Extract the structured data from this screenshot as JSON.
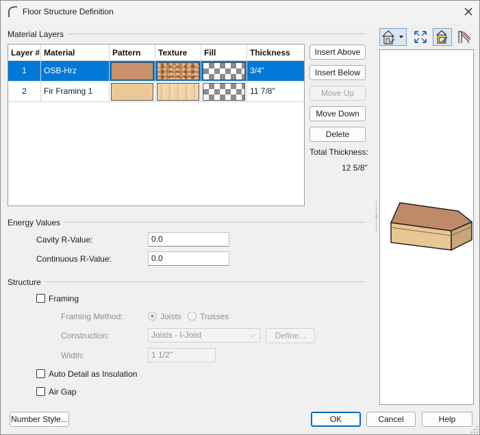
{
  "window": {
    "title": "Floor Structure Definition"
  },
  "material_layers": {
    "section_label": "Material Layers",
    "columns": [
      "Layer #",
      "Material",
      "Pattern",
      "Texture",
      "Fill",
      "Thickness"
    ],
    "rows": [
      {
        "layer": "1",
        "material": "OSB-Hrz",
        "thickness": "3/4\"",
        "selected": true
      },
      {
        "layer": "2",
        "material": "Fir Framing 1",
        "thickness": "11 7/8\"",
        "selected": false
      }
    ],
    "buttons": {
      "insert_above": "Insert Above",
      "insert_below": "Insert Below",
      "move_up": "Move Up",
      "move_down": "Move Down",
      "delete": "Delete"
    },
    "total_thickness_label": "Total Thickness:",
    "total_thickness_value": "12 5/8\""
  },
  "energy_values": {
    "section_label": "Energy Values",
    "cavity_label": "Cavity R-Value:",
    "cavity_value": "0.0",
    "continuous_label": "Continuous R-Value:",
    "continuous_value": "0.0"
  },
  "structure": {
    "section_label": "Structure",
    "framing_label": "Framing",
    "framing_checked": false,
    "framing_method_label": "Framing Method:",
    "joists_label": "Joists",
    "trusses_label": "Trusses",
    "construction_label": "Construction:",
    "construction_value": "Joists - I-Joist",
    "define_button": "Define...",
    "width_label": "Width:",
    "width_value": "1 1/2\"",
    "auto_detail_label": "Auto Detail as Insulation",
    "air_gap_label": "Air Gap"
  },
  "footer": {
    "number_style": "Number Style...",
    "ok": "OK",
    "cancel": "Cancel",
    "help": "Help"
  },
  "colors": {
    "selection": "#0078d7",
    "osb_pattern": "#c9926e",
    "fir_pattern": "#ebc896",
    "preview_top": "#c08a68",
    "preview_side": "#e8c795"
  },
  "icons": {
    "toolbar": [
      "view-type-icon",
      "fill-window-icon",
      "select-objects-icon",
      "layer-display-icon"
    ]
  }
}
